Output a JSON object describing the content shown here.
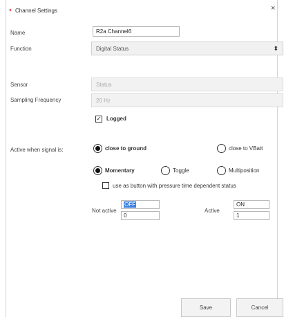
{
  "window": {
    "title": "Channel Settings",
    "close_glyph": "×"
  },
  "form": {
    "name": {
      "label": "Name",
      "value": "R2a Channel6"
    },
    "function": {
      "label": "Function",
      "value": "Digital Status"
    },
    "sensor": {
      "label": "Sensor",
      "value": "Status"
    },
    "sampling_frequency": {
      "label": "Sampling Frequency",
      "value": "20 Hz"
    },
    "logged": {
      "label": "Logged",
      "checked": true
    }
  },
  "active_when": {
    "label": "Active when signal is:",
    "close_to_ground": {
      "label": "close to ground",
      "checked": true
    },
    "close_to_vbatt": {
      "label": "close to VBatt",
      "checked": false
    }
  },
  "mode": {
    "momentary": {
      "label": "Momentary",
      "checked": true
    },
    "toggle": {
      "label": "Toggle",
      "checked": false
    },
    "multiposition": {
      "label": "Multiposition",
      "checked": false
    },
    "pressure_time": {
      "label": "use as button with pressure time dependent status",
      "checked": false
    }
  },
  "states": {
    "not_active": {
      "label": "Not active",
      "text": "OFF",
      "value": "0"
    },
    "active": {
      "label": "Active",
      "text": "ON",
      "value": "1"
    }
  },
  "buttons": {
    "save": "Save",
    "cancel": "Cancel"
  },
  "colors": {
    "selection": "#3b7fe0"
  }
}
